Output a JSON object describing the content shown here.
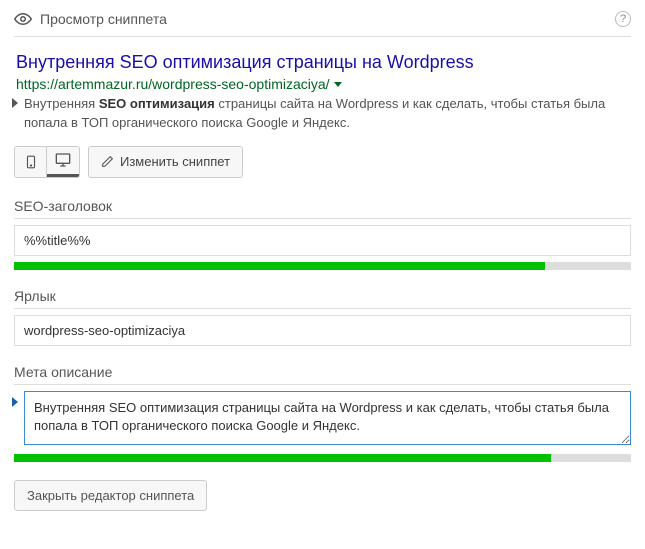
{
  "header": {
    "title": "Просмотр сниппета"
  },
  "preview": {
    "title": "Внутренняя SEO оптимизация страницы на Wordpress",
    "url": "https://artemmazur.ru/wordpress-seo-optimizaciya/",
    "desc_prefix": "Внутренняя ",
    "desc_bold": "SEO оптимизация",
    "desc_suffix": " страницы сайта на Wordpress и как сделать, чтобы статья была попала в ТОП органического поиска Google и Яндекс."
  },
  "buttons": {
    "edit_snippet": "Изменить сниппет",
    "close_editor": "Закрыть редактор сниппета"
  },
  "fields": {
    "seo_title": {
      "label": "SEO-заголовок",
      "value": "%%title%%",
      "progress": 86
    },
    "slug": {
      "label": "Ярлык",
      "value": "wordpress-seo-optimizaciya"
    },
    "meta_desc": {
      "label": "Мета описание",
      "value": "Внутренняя SEO оптимизация страницы сайта на Wordpress и как сделать, чтобы статья была попала в ТОП органического поиска Google и Яндекс.",
      "progress": 87
    }
  }
}
